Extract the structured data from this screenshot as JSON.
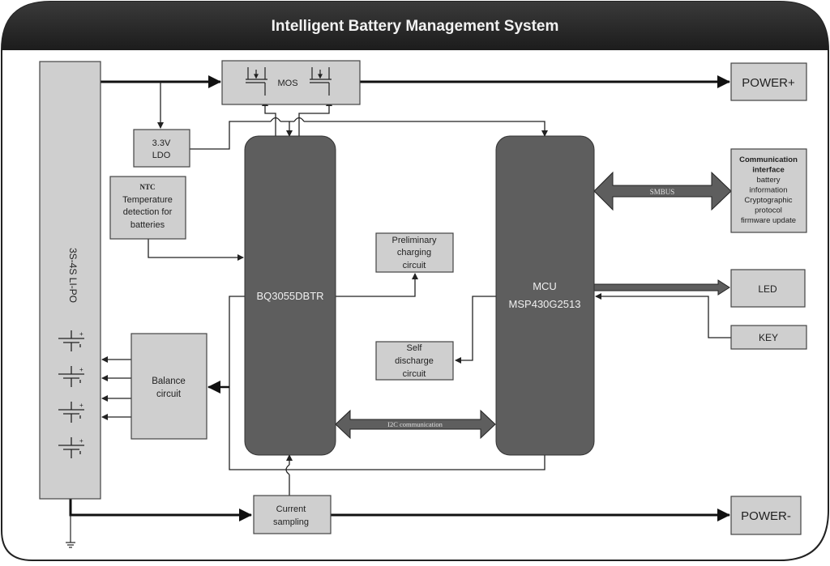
{
  "title": "Intelligent Battery Management System",
  "colors": {
    "header": "#2a2a2a",
    "box_fill": "#cfcfcf",
    "chip_fill": "#5e5e5e",
    "line": "#222222",
    "chip_text": "#f0f0f0"
  },
  "blocks": {
    "battery_pack": {
      "label": "3S-4S LI-PO",
      "cells": 4
    },
    "mos": {
      "label": "MOS"
    },
    "ldo": {
      "line1": "3.3V",
      "line2": "LDO"
    },
    "ntc": {
      "line1": "NTC",
      "line2": "Temperature",
      "line3": "detection for",
      "line4": "batteries"
    },
    "bq": {
      "label": "BQ3055DBTR"
    },
    "mcu": {
      "line1": "MCU",
      "line2": "MSP430G2513"
    },
    "preliminary_charging": {
      "line1": "Preliminary",
      "line2": "charging",
      "line3": "circuit"
    },
    "self_discharge": {
      "line1": "Self",
      "line2": "discharge",
      "line3": "circuit"
    },
    "balance": {
      "line1": "Balance",
      "line2": "circuit"
    },
    "current_sampling": {
      "line1": "Current",
      "line2": "sampling"
    },
    "power_plus": {
      "label": "POWER+"
    },
    "power_minus": {
      "label": "POWER-"
    },
    "comm_interface": {
      "lines": [
        "Communication",
        "interface",
        "battery",
        "information",
        "Cryptographic",
        "protocol",
        "firmware update"
      ]
    },
    "led": {
      "label": "LED"
    },
    "key": {
      "label": "KEY"
    }
  },
  "buses": {
    "smbus": {
      "label": "SMBUS"
    },
    "i2c": {
      "label": "I2C communication"
    }
  }
}
